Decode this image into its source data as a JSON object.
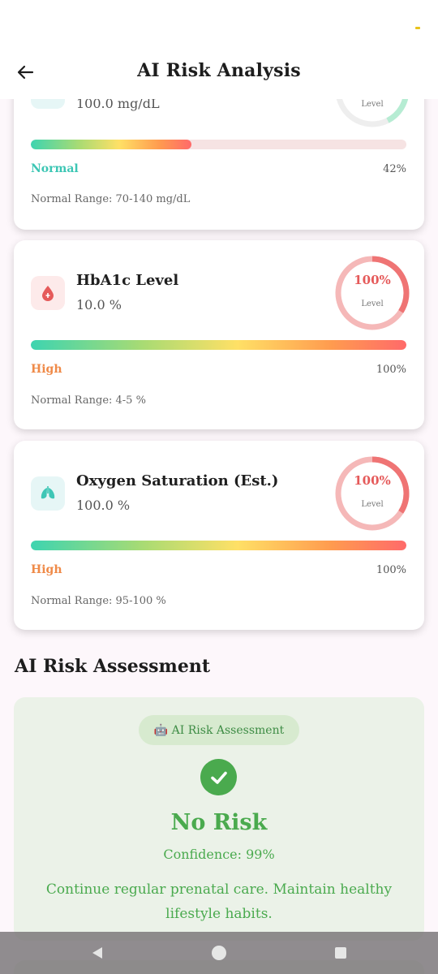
{
  "app_bar": {
    "title": "AI Risk Analysis"
  },
  "metrics": [
    {
      "name": "",
      "value": "100.0 mg/dL",
      "gauge_percent": "",
      "gauge_label": "Level",
      "status": "Normal",
      "percent": "42%",
      "fill_fraction": 0.428,
      "range": "Normal Range: 70-140 mg/dL"
    },
    {
      "name": "HbA1c Level",
      "value": "10.0 %",
      "gauge_percent": "100%",
      "gauge_label": "Level",
      "status": "High",
      "percent": "100%",
      "fill_fraction": 1.0,
      "range": "Normal Range: 4-5 %"
    },
    {
      "name": "Oxygen Saturation (Est.)",
      "value": "100.0 %",
      "gauge_percent": "100%",
      "gauge_label": "Level",
      "status": "High",
      "percent": "100%",
      "fill_fraction": 1.0,
      "range": "Normal Range: 95-100 %"
    }
  ],
  "section": {
    "title": "AI Risk Assessment"
  },
  "assessment": {
    "badge": "🤖 AI Risk Assessment",
    "result": "No Risk",
    "confidence": "Confidence: 99%",
    "advice": "Continue regular prenatal care. Maintain healthy lifestyle habits."
  },
  "colors": {
    "normal": "#3cc6b4",
    "high": "#ef8a48",
    "gauge_red": "#e55a5a",
    "success": "#4aaa4e"
  },
  "icons": {
    "back": "arrow-left-icon",
    "blood_drop": "blood-drop-icon",
    "lungs": "lungs-icon",
    "check": "check-circle-icon"
  }
}
